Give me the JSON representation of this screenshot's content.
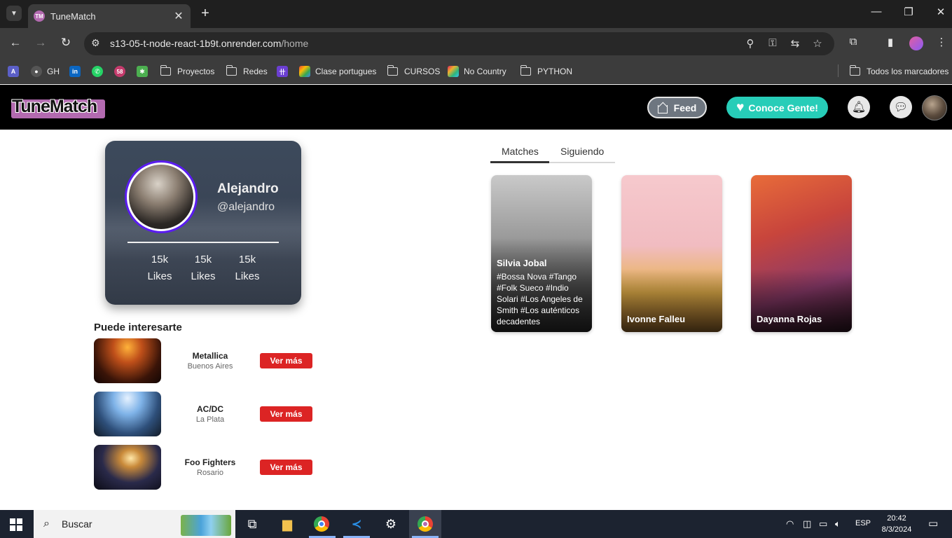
{
  "browser": {
    "tab_title": "TuneMatch",
    "tab_favicon_letters": "TM",
    "url_host": "s13-05-t-node-react-1b9t.onrender.com",
    "url_path": "/home",
    "bookmarks": [
      {
        "label": "GH",
        "type": "github"
      },
      {
        "label": "Proyectos",
        "type": "folder"
      },
      {
        "label": "Redes",
        "type": "folder"
      },
      {
        "label": "Clase portugues",
        "type": "google"
      },
      {
        "label": "CURSOS",
        "type": "folder"
      },
      {
        "label": "No Country",
        "type": "slack"
      },
      {
        "label": "PYTHON",
        "type": "folder"
      }
    ],
    "all_bookmarks": "Todos los marcadores",
    "badge_count": "58"
  },
  "header": {
    "logo_text": "TuneMatch",
    "feed_label": "Feed",
    "conoce_label": "Conoce Gente!",
    "icons": [
      "bell-icon",
      "chat-icon"
    ],
    "accent_color": "#27cdb8",
    "logo_color": "#b36ab0"
  },
  "profile": {
    "name": "Alejandro",
    "handle": "@alejandro",
    "stats": [
      {
        "value": "15k",
        "label": "Likes"
      },
      {
        "value": "15k",
        "label": "Likes"
      },
      {
        "value": "15k",
        "label": "Likes"
      }
    ],
    "ring_color": "#5a1cf0"
  },
  "recommendations": {
    "title": "Puede interesarte",
    "button_label": "Ver más",
    "button_color": "#dc2424",
    "items": [
      {
        "name": "Metallica",
        "place": "Buenos Aires"
      },
      {
        "name": "AC/DC",
        "place": "La Plata"
      },
      {
        "name": "Foo Fighters",
        "place": "Rosario"
      }
    ]
  },
  "tabs": {
    "matches": "Matches",
    "siguiendo": "Siguiendo",
    "active": "Matches"
  },
  "matches": [
    {
      "name": "Silvia Jobal",
      "tags": "#Bossa Nova #Tango #Folk Sueco #Indio Solari #Los Angeles de Smith #Los auténticos decadentes"
    },
    {
      "name": "Ivonne Falleu",
      "tags": ""
    },
    {
      "name": "Dayanna Rojas",
      "tags": ""
    }
  ],
  "taskbar": {
    "search_placeholder": "Buscar",
    "language": "ESP",
    "time": "20:42",
    "date": "8/3/2024"
  }
}
